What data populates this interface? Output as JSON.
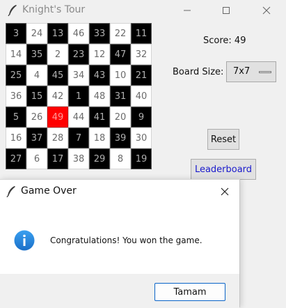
{
  "main_window": {
    "title": "Knight's Tour",
    "score_label": "Score: 49",
    "board_size_label": "Board Size:",
    "board_size_value": "7x7",
    "reset_label": "Reset",
    "leaderboard_label": "Leaderboard",
    "board": [
      [
        "3",
        "24",
        "13",
        "46",
        "33",
        "22",
        "11"
      ],
      [
        "14",
        "35",
        "2",
        "23",
        "12",
        "47",
        "32"
      ],
      [
        "25",
        "4",
        "45",
        "34",
        "43",
        "10",
        "21"
      ],
      [
        "36",
        "15",
        "42",
        "1",
        "48",
        "31",
        "40"
      ],
      [
        "5",
        "26",
        "49",
        "44",
        "41",
        "20",
        "9"
      ],
      [
        "16",
        "37",
        "28",
        "7",
        "18",
        "39",
        "30"
      ],
      [
        "27",
        "6",
        "17",
        "38",
        "29",
        "8",
        "19"
      ]
    ],
    "current_square": "49",
    "colors": {
      "dark_square": "#000000",
      "light_square": "#ffffff",
      "current_square": "#ff0000",
      "leaderboard_text": "#1a1acc"
    }
  },
  "dialog": {
    "title": "Game Over",
    "message": "Congratulations! You won the game.",
    "ok_label": "Tamam",
    "icon": "info-icon"
  }
}
